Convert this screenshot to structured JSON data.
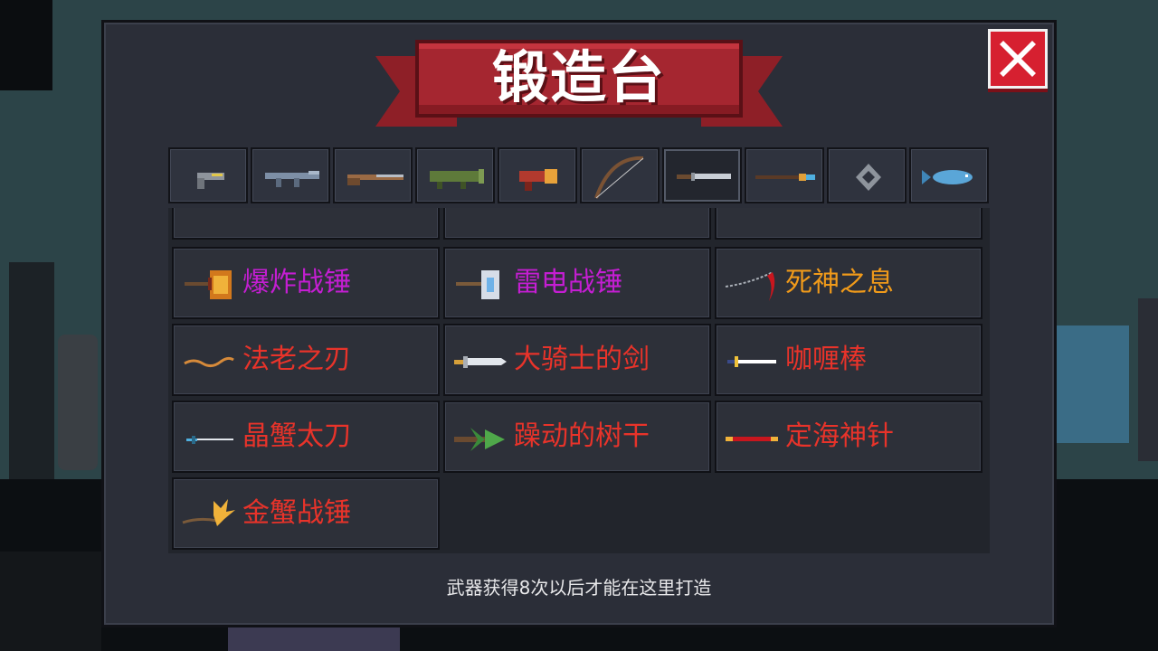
{
  "title": "锻造台",
  "close_icon": "close-x-icon",
  "tabs": [
    {
      "icon": "pistol-icon",
      "active": false
    },
    {
      "icon": "assault-rifle-icon",
      "active": false
    },
    {
      "icon": "shotgun-icon",
      "active": false
    },
    {
      "icon": "rocket-launcher-icon",
      "active": false
    },
    {
      "icon": "laser-gun-icon",
      "active": false
    },
    {
      "icon": "bow-icon",
      "active": false
    },
    {
      "icon": "sword-icon",
      "active": true
    },
    {
      "icon": "staff-icon",
      "active": false
    },
    {
      "icon": "shuriken-icon",
      "active": false
    },
    {
      "icon": "fish-icon",
      "active": false
    }
  ],
  "weapons": [
    {
      "name": "爆炸战锤",
      "color": "#c41ed2",
      "icon": "explosive-hammer-icon"
    },
    {
      "name": "雷电战锤",
      "color": "#c41ed2",
      "icon": "thunder-hammer-icon"
    },
    {
      "name": "死神之息",
      "color": "#f09a1a",
      "icon": "scythe-icon"
    },
    {
      "name": "法老之刃",
      "color": "#e8332a",
      "icon": "pharaoh-blade-icon"
    },
    {
      "name": "大骑士的剑",
      "color": "#e8332a",
      "icon": "knight-sword-icon"
    },
    {
      "name": "咖喱棒",
      "color": "#e8332a",
      "icon": "excalibur-icon"
    },
    {
      "name": "晶蟹太刀",
      "color": "#e8332a",
      "icon": "crystal-katana-icon"
    },
    {
      "name": "躁动的树干",
      "color": "#e8332a",
      "icon": "tree-trunk-icon"
    },
    {
      "name": "定海神针",
      "color": "#e8332a",
      "icon": "golden-staff-icon"
    },
    {
      "name": "金蟹战锤",
      "color": "#e8332a",
      "icon": "gold-crab-hammer-icon"
    }
  ],
  "note": "武器获得8次以后才能在这里打造",
  "colors": {
    "panel": "#2b2e38",
    "banner": "#a52630",
    "close": "#d62030"
  }
}
